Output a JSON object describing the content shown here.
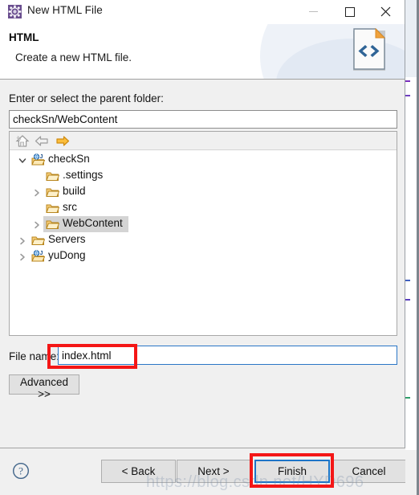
{
  "window": {
    "title": "New HTML File",
    "icon": "wizard-gear-icon",
    "controls": {
      "minimize_label": "—",
      "maximize_label": "□",
      "close_label": "✕"
    }
  },
  "header": {
    "title": "HTML",
    "description": "Create a new HTML file.",
    "icon": "html-file-icon"
  },
  "body": {
    "parent_folder_label": "Enter or select the parent folder:",
    "parent_folder_value": "checkSn/WebContent",
    "parent_folder_placeholder": "",
    "file_name_label": "File name:",
    "file_name_value": "index.html",
    "file_name_placeholder": "",
    "advanced_label": "Advanced >>"
  },
  "tree": {
    "toolbar": [
      {
        "name": "home-icon",
        "enabled": false
      },
      {
        "name": "back-arrow-icon",
        "enabled": false
      },
      {
        "name": "forward-arrow-icon",
        "enabled": true
      }
    ],
    "items": [
      {
        "label": "checkSn",
        "icon": "web-project-icon",
        "indent": 0,
        "twisty": "down",
        "selected": false
      },
      {
        "label": ".settings",
        "icon": "folder-icon",
        "indent": 1,
        "twisty": "none",
        "selected": false
      },
      {
        "label": "build",
        "icon": "folder-icon",
        "indent": 1,
        "twisty": "right",
        "selected": false
      },
      {
        "label": "src",
        "icon": "folder-icon",
        "indent": 1,
        "twisty": "none",
        "selected": false
      },
      {
        "label": "WebContent",
        "icon": "folder-icon",
        "indent": 1,
        "twisty": "right",
        "selected": true
      },
      {
        "label": "Servers",
        "icon": "folder-icon",
        "indent": 0,
        "twisty": "right",
        "selected": false
      },
      {
        "label": "yuDong",
        "icon": "web-project-icon",
        "indent": 0,
        "twisty": "right",
        "selected": false
      }
    ]
  },
  "footer": {
    "help_icon": "help-question-icon",
    "back_label": "< Back",
    "next_label": "Next >",
    "finish_label": "Finish",
    "cancel_label": "Cancel"
  },
  "watermark": {
    "text": "https://blog.csdn.net/HYD696"
  },
  "colors": {
    "focus_blue": "#1d74c7",
    "annotation_red": "#f41616",
    "dialog_bg": "#f0f0f0",
    "folder_orange": "#f5b740",
    "selection_gray": "#d4d4d4"
  }
}
